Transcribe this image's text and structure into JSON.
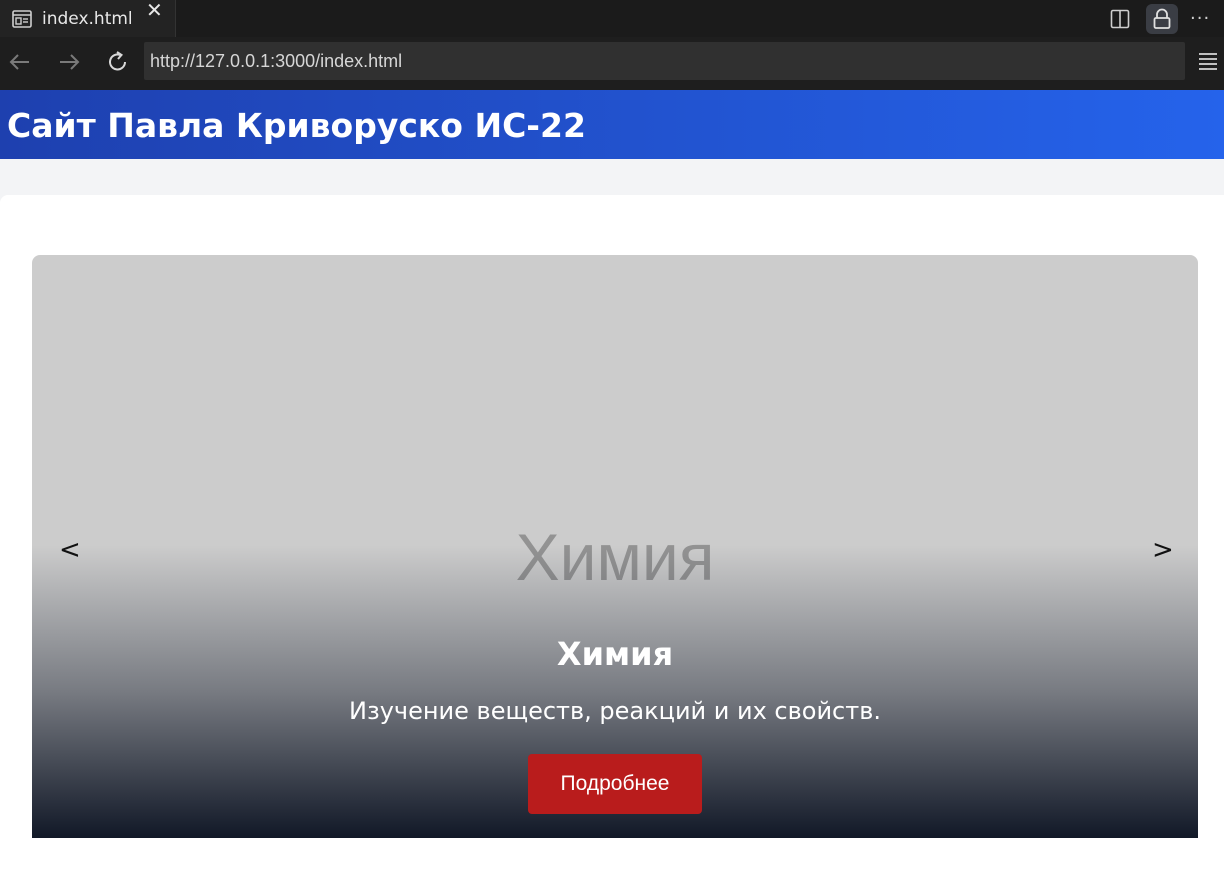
{
  "browser": {
    "tab_title": "index.html",
    "tab_close": "✕",
    "url": "http://127.0.0.1:3000/index.html",
    "more_menu": "···"
  },
  "header": {
    "title": "Сайт Павла Криворуско ИС-22"
  },
  "carousel": {
    "slide_image_text": "Химия",
    "caption_title": "Химия",
    "caption_text": "Изучение веществ, реакций и их свойств.",
    "button_label": "Подробнее",
    "prev_label": "<",
    "next_label": ">"
  },
  "colors": {
    "header_start": "#1e40af",
    "header_end": "#2563eb",
    "button": "#b91c1c",
    "slide_bg": "#cccccc"
  }
}
